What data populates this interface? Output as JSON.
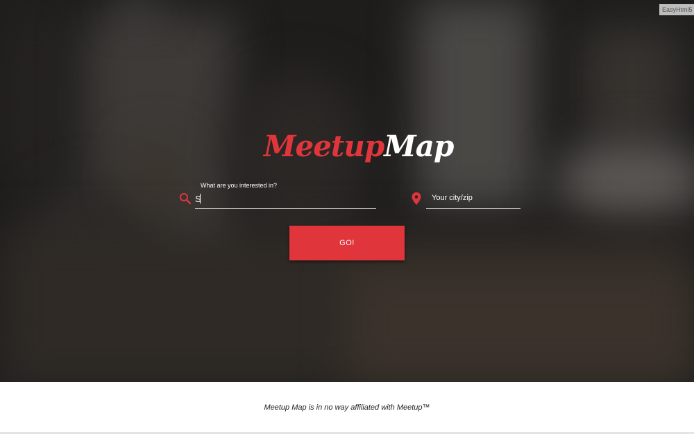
{
  "brand": {
    "logo_part1": "Meetup",
    "logo_part2": "Map",
    "red": "#e0353b",
    "white": "#ffffff"
  },
  "watermark": "EasyHtml5",
  "search": {
    "label": "What are you interested in?",
    "value": "S",
    "icon": "search-icon"
  },
  "location": {
    "placeholder": "Your city/zip",
    "icon": "location-pin-icon"
  },
  "actions": {
    "go_label": "GO!"
  },
  "footer": {
    "text": "Meetup Map is in no way affiliated with Meetup™"
  }
}
